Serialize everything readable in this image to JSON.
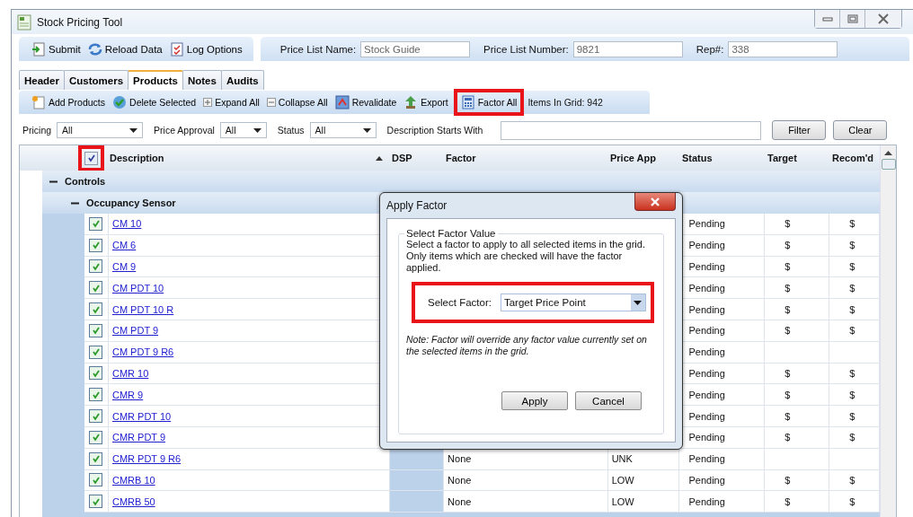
{
  "window": {
    "title": "Stock Pricing Tool"
  },
  "top_toolbar": {
    "buttons": [
      {
        "label": "Submit"
      },
      {
        "label": "Reload Data"
      },
      {
        "label": "Log Options"
      }
    ],
    "fields": [
      {
        "label": "Price List Name:",
        "value": "Stock Guide"
      },
      {
        "label": "Price List Number:",
        "value": "9821"
      },
      {
        "label": "Rep#:",
        "value": "338"
      }
    ]
  },
  "tabs": [
    {
      "label": "Header",
      "selected": false
    },
    {
      "label": "Customers",
      "selected": false
    },
    {
      "label": "Products",
      "selected": true
    },
    {
      "label": "Notes",
      "selected": false
    },
    {
      "label": "Audits",
      "selected": false
    }
  ],
  "products_toolbar": {
    "buttons": [
      {
        "label": "Add Products",
        "highlighted": false
      },
      {
        "label": "Delete Selected",
        "highlighted": false
      },
      {
        "label": "Expand All",
        "highlighted": false
      },
      {
        "label": "Collapse All",
        "highlighted": false
      },
      {
        "label": "Revalidate",
        "highlighted": false
      },
      {
        "label": "Export",
        "highlighted": false
      },
      {
        "label": "Factor All",
        "highlighted": true
      }
    ],
    "items_count": "Items In Grid: 942"
  },
  "filters": [
    {
      "label": "Pricing",
      "value": "All"
    },
    {
      "label": "Price Approval",
      "value": "All"
    },
    {
      "label": "Status",
      "value": "All"
    }
  ],
  "description_filter": {
    "label": "Description Starts With"
  },
  "filter_buttons": [
    "Filter",
    "Clear"
  ],
  "grid": {
    "select_all": {
      "checked": true,
      "highlighted": true
    },
    "columns": [
      {
        "label": "Description",
        "sorted": true
      },
      {
        "label": "DSP",
        "sorted": false
      },
      {
        "label": "Factor",
        "sorted": false
      },
      {
        "label": "Price App",
        "sorted": false
      },
      {
        "label": "Status",
        "sorted": false
      },
      {
        "label": "Target",
        "sorted": false
      },
      {
        "label": "Recom'd",
        "sorted": false
      }
    ],
    "groups": [
      {
        "label": "Controls",
        "expanded": true,
        "children": [
          {
            "label": "Occupancy Sensor",
            "expanded": true,
            "rows": [
              {
                "description": "CM 10",
                "checked": true,
                "status": "Pending",
                "target": "$",
                "recommended": "$"
              },
              {
                "description": "CM 6",
                "checked": true,
                "status": "Pending",
                "target": "$",
                "recommended": "$"
              },
              {
                "description": "CM 9",
                "checked": true,
                "status": "Pending",
                "target": "$",
                "recommended": "$"
              },
              {
                "description": "CM PDT 10",
                "checked": true,
                "status": "Pending",
                "target": "$",
                "recommended": "$"
              },
              {
                "description": "CM PDT 10 R",
                "checked": true,
                "status": "Pending",
                "target": "$",
                "recommended": "$"
              },
              {
                "description": "CM PDT 9",
                "checked": true,
                "status": "Pending",
                "target": "$",
                "recommended": "$"
              },
              {
                "description": "CM PDT 9 R6",
                "checked": true,
                "status": "Pending"
              },
              {
                "description": "CMR 10",
                "checked": true,
                "status": "Pending",
                "target": "$",
                "recommended": "$"
              },
              {
                "description": "CMR 9",
                "checked": true,
                "status": "Pending",
                "target": "$",
                "recommended": "$"
              },
              {
                "description": "CMR PDT 10",
                "checked": true,
                "status": "Pending",
                "target": "$",
                "recommended": "$"
              },
              {
                "description": "CMR PDT 9",
                "checked": true,
                "status": "Pending",
                "target": "$",
                "recommended": "$"
              },
              {
                "description": "CMR PDT 9 R6",
                "checked": true,
                "factor": "None",
                "price_app": "UNK",
                "status": "Pending"
              },
              {
                "description": "CMRB 10",
                "checked": true,
                "factor": "None",
                "price_app": "LOW",
                "status": "Pending",
                "target": "$",
                "recommended": "$"
              },
              {
                "description": "CMRB 50",
                "checked": true,
                "factor": "None",
                "price_app": "LOW",
                "status": "Pending",
                "target": "$",
                "recommended": "$"
              }
            ]
          }
        ]
      }
    ]
  },
  "dialog": {
    "title": "Apply Factor",
    "group_title": "Select Factor Value",
    "description": "Select a factor to apply to all selected items in the grid. Only items which are checked will have the factor applied.",
    "select": {
      "label": "Select Factor:",
      "value": "Target Price Point",
      "highlighted": true
    },
    "note": "Note: Factor will override any factor value currently set on the selected items in the grid.",
    "buttons": [
      "Apply",
      "Cancel"
    ]
  }
}
